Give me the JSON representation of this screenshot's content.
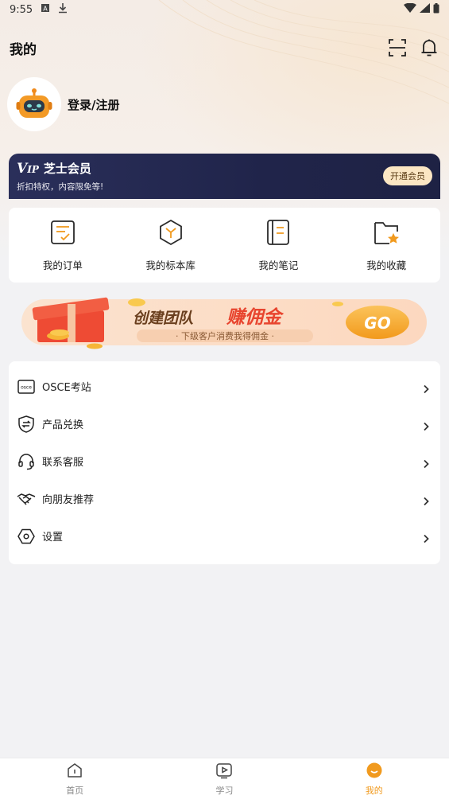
{
  "status_bar": {
    "time": "9:55"
  },
  "header": {
    "title": "我的",
    "icons": [
      "scan-icon",
      "bell-icon"
    ]
  },
  "profile": {
    "login_label": "登录/注册"
  },
  "vip": {
    "logo": "VIP",
    "name": "芝士会员",
    "subtitle": "折扣特权，内容限免等!",
    "button_label": "开通会员"
  },
  "shortcuts": [
    {
      "label": "我的订单",
      "icon": "order-icon"
    },
    {
      "label": "我的标本库",
      "icon": "cube-icon"
    },
    {
      "label": "我的笔记",
      "icon": "notebook-icon"
    },
    {
      "label": "我的收藏",
      "icon": "folder-star-icon"
    }
  ],
  "banner": {
    "title_part1": "创建团队",
    "title_part2": "赚佣金",
    "subtitle": "· 下级客户消费我得佣金 ·",
    "go_label": "GO"
  },
  "menu": [
    {
      "label": "OSCE考站",
      "icon": "osce-icon"
    },
    {
      "label": "产品兑换",
      "icon": "shield-exchange-icon"
    },
    {
      "label": "联系客服",
      "icon": "headset-icon"
    },
    {
      "label": "向朋友推荐",
      "icon": "handshake-icon"
    },
    {
      "label": "设置",
      "icon": "settings-icon"
    }
  ],
  "bottom_nav": [
    {
      "label": "首页",
      "icon": "home-icon",
      "active": false
    },
    {
      "label": "学习",
      "icon": "play-icon",
      "active": false
    },
    {
      "label": "我的",
      "icon": "me-icon",
      "active": true
    }
  ],
  "colors": {
    "accent": "#f19a1e",
    "vip_bg": "#22264c",
    "vip_button": "#fbe6c3",
    "banner_red": "#e8452f"
  }
}
